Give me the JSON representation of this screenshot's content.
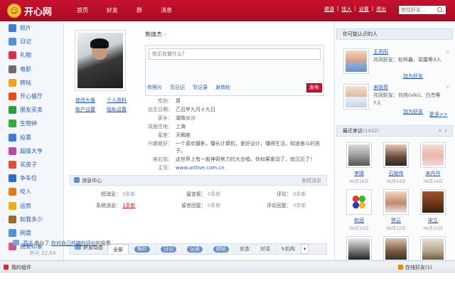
{
  "app": {
    "logo_text": "开心网",
    "logo_glyph": "☺"
  },
  "nav": [
    "首页",
    "好友",
    "群",
    "消息"
  ],
  "top_links": [
    "邀请",
    "找人",
    "设置",
    "退出"
  ],
  "top_search": {
    "placeholder": "查找好友..."
  },
  "sidebar": {
    "items": [
      {
        "label": "照片",
        "color": "#3e7bd1"
      },
      {
        "label": "日记",
        "color": "#5a8fd8"
      },
      {
        "label": "礼物",
        "color": "#d8324a"
      },
      {
        "label": "电影",
        "color": "#6c6c6c"
      },
      {
        "label": "转帖",
        "color": "#f0a21d"
      },
      {
        "label": "开心餐厅",
        "color": "#e04c1e"
      },
      {
        "label": "朋友买卖",
        "color": "#2f9a3f"
      },
      {
        "label": "生物钟",
        "color": "#3aa83a"
      },
      {
        "label": "投票",
        "color": "#3e7bd1"
      },
      {
        "label": "超级大亨",
        "color": "#b84aa6"
      },
      {
        "label": "买房子",
        "color": "#d8503a"
      },
      {
        "label": "争车位",
        "color": "#2b6fc9"
      },
      {
        "label": "咬人",
        "color": "#e07a1e"
      },
      {
        "label": "运势",
        "color": "#e0b41e"
      },
      {
        "label": "知我多少",
        "color": "#9a6a2a"
      },
      {
        "label": "网盘",
        "color": "#5b8fd6"
      },
      {
        "label": "朋友印象",
        "color": "#c85a8a"
      }
    ]
  },
  "profile": {
    "name": "熊焕杰",
    "status_placeholder": "你正在做什么？",
    "status_actions": [
      "传照片",
      "写日记",
      "写记录",
      "发转帖"
    ],
    "publish_label": "发布",
    "avatar_links": [
      "修改头像",
      "个人资料",
      "账户设置",
      "隐私设置"
    ],
    "fields": [
      {
        "key": "性别：",
        "value": "男"
      },
      {
        "key": "出生日期：",
        "value": "乙丑年九月十九日"
      },
      {
        "key": "家乡：",
        "value": "湖南长沙"
      },
      {
        "key": "现居住地：",
        "value": "上海"
      },
      {
        "key": "星座：",
        "value": "天蝎座"
      },
      {
        "key": "兴趣爱好：",
        "value": "一个喜欢摄影，擅长计算机，爱好设计，懂得生活，知道奋斗的孩子。"
      },
      {
        "key": "座右铭：",
        "value": "这世界上有一股神奇势力的大合唱，你如果爱动了，就沉沦了！"
      },
      {
        "key": "主页：",
        "value": "www.artlive.com.cn",
        "link": true
      }
    ]
  },
  "messages": {
    "title": "消息中心",
    "right_link": "发短消息",
    "items": [
      {
        "label": "短消息：",
        "value": "0条新"
      },
      {
        "label": "留言板：",
        "value": "0条新"
      },
      {
        "label": "评论：",
        "value": "0条新"
      },
      {
        "label": "系统消息：",
        "value": "1条新",
        "highlight": true
      },
      {
        "label": "留言回复：",
        "value": "0条新"
      },
      {
        "label": "评论回复：",
        "value": "0条新"
      }
    ]
  },
  "feed": {
    "title": "好友动态",
    "tabs": [
      {
        "label": "全部",
        "active": true
      },
      {
        "label": "照片",
        "pill": true
      },
      {
        "label": "日记",
        "pill": true
      },
      {
        "label": "记录",
        "pill": true
      },
      {
        "label": "转帖",
        "pill": true
      },
      {
        "label": "状态"
      },
      {
        "label": "对话"
      },
      {
        "label": "↯机构"
      }
    ],
    "more_label": "▾",
    "item": {
      "user": "高洁",
      "action": "参与了",
      "target": "你对自己外貌的评价",
      "suffix": "的投票"
    },
    "time": "昨天 22:54"
  },
  "suggest": {
    "title": "你可能认识的人",
    "people": [
      {
        "name": "王高阳",
        "desc": "共同好友：赵柯鑫、梁露等3人",
        "add": "加为好友"
      },
      {
        "name": "宋晓菲",
        "desc": "共同好友：刘伟(viki)、白杰等7人",
        "add": "加为好友"
      }
    ],
    "more": "更多>>"
  },
  "visitors": {
    "title": "最近来访",
    "count": "(1432)",
    "people": [
      {
        "name": "李婧",
        "date": "06月16日"
      },
      {
        "name": "石晓伟",
        "date": "06月14日"
      },
      {
        "name": "宋丹丹",
        "date": "06月14日"
      },
      {
        "name": "和冠",
        "date": "06月14日"
      },
      {
        "name": "贺云",
        "date": "06月12日"
      },
      {
        "name": "宋立",
        "date": "06月10日"
      },
      {
        "name": "",
        "date": ""
      },
      {
        "name": "",
        "date": ""
      },
      {
        "name": "",
        "date": ""
      }
    ],
    "tools": "✕ ⇧"
  },
  "bottom": {
    "mine": "我的组件",
    "online": "在线好友(1)"
  }
}
